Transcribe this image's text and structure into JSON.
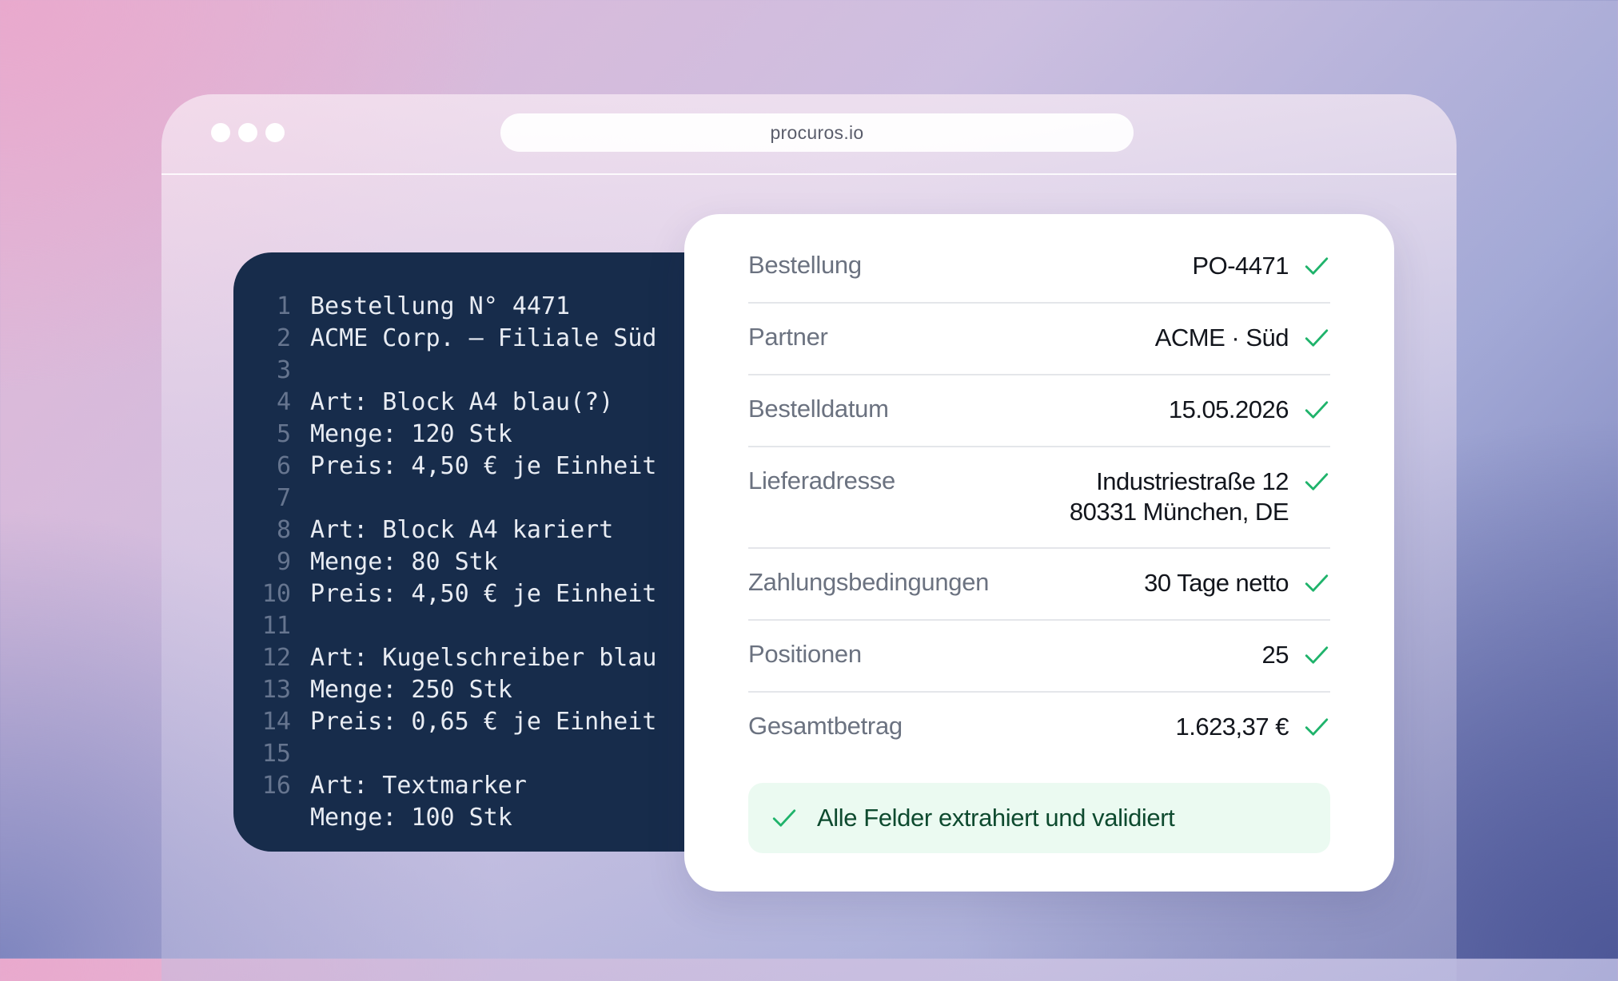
{
  "browser": {
    "url": "procuros.io"
  },
  "code": {
    "lines": [
      {
        "n": "1",
        "text": "Bestellung N° 4471"
      },
      {
        "n": "2",
        "text": "ACME Corp. — Filiale Süd"
      },
      {
        "n": "3",
        "text": ""
      },
      {
        "n": "4",
        "text": "Art: Block A4 blau(?)"
      },
      {
        "n": "5",
        "text": "Menge: 120 Stk"
      },
      {
        "n": "6",
        "text": "Preis: 4,50 € je Einheit"
      },
      {
        "n": "7",
        "text": ""
      },
      {
        "n": "8",
        "text": "Art: Block A4 kariert"
      },
      {
        "n": "9",
        "text": "Menge: 80 Stk"
      },
      {
        "n": "10",
        "text": "Preis: 4,50 € je Einheit"
      },
      {
        "n": "11",
        "text": ""
      },
      {
        "n": "12",
        "text": "Art: Kugelschreiber blau"
      },
      {
        "n": "13",
        "text": "Menge: 250 Stk"
      },
      {
        "n": "14",
        "text": "Preis: 0,65 € je Einheit"
      },
      {
        "n": "15",
        "text": ""
      },
      {
        "n": "16",
        "text": "Art: Textmarker"
      },
      {
        "n": "",
        "text": "Menge: 100 Stk"
      }
    ]
  },
  "extraction": {
    "fields": [
      {
        "label": "Bestellung",
        "value": "PO-4471",
        "icon": "check-icon"
      },
      {
        "label": "Partner",
        "value": "ACME · Süd",
        "icon": "check-icon"
      },
      {
        "label": "Bestelldatum",
        "value": "15.05.2026",
        "icon": "check-icon"
      },
      {
        "label": "Lieferadresse",
        "value": "Industriestraße 12\n80331 München, DE",
        "icon": "check-icon"
      },
      {
        "label": "Zahlungsbedingungen",
        "value": "30 Tage netto",
        "icon": "check-icon"
      },
      {
        "label": "Positionen",
        "value": "25",
        "icon": "check-icon"
      },
      {
        "label": "Gesamtbetrag",
        "value": "1.623,37 €",
        "icon": "check-icon"
      }
    ],
    "status": "Alle Felder extrahiert und validiert"
  },
  "colors": {
    "check": "#1fb36b",
    "code_bg": "#172c4b",
    "status_bg": "#ebfaf1"
  }
}
